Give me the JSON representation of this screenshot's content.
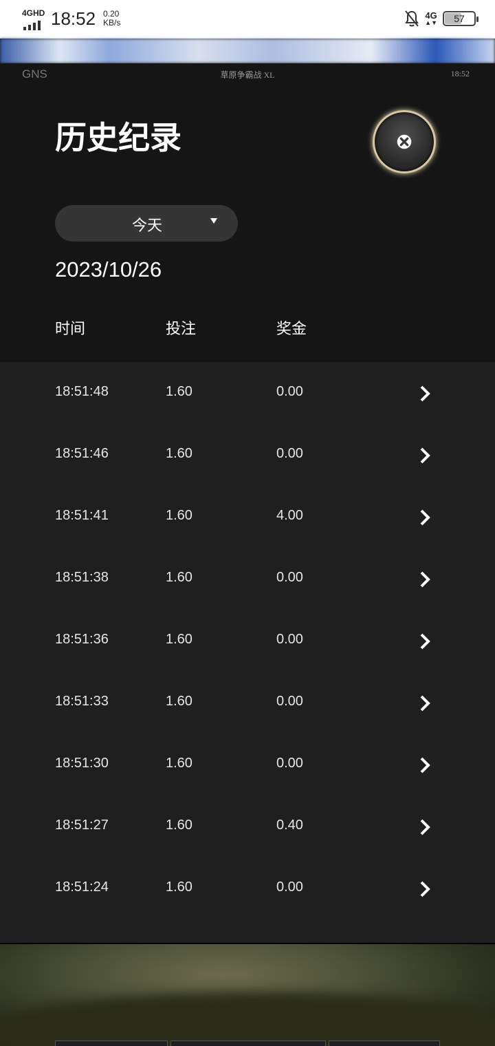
{
  "status_bar": {
    "network_label": "4GHD",
    "time": "18:52",
    "speed_value": "0.20",
    "speed_unit": "KB/s",
    "mobile_data_label": "4G",
    "battery_level": "57",
    "icons": [
      "signal-icon",
      "bell-off-icon",
      "mobile-data-icon",
      "battery-icon"
    ]
  },
  "game_header": {
    "brand": "GNS",
    "game_title": "草原争霸战 XL",
    "clock": "18:52"
  },
  "history": {
    "title": "历史纪录",
    "close_icon": "close-icon",
    "date_filter": {
      "selected": "今天"
    },
    "date": "2023/10/26",
    "columns": [
      "时间",
      "投注",
      "奖金"
    ],
    "rows": [
      {
        "time": "18:51:48",
        "bet": "1.60",
        "win": "0.00"
      },
      {
        "time": "18:51:46",
        "bet": "1.60",
        "win": "0.00"
      },
      {
        "time": "18:51:41",
        "bet": "1.60",
        "win": "4.00"
      },
      {
        "time": "18:51:38",
        "bet": "1.60",
        "win": "0.00"
      },
      {
        "time": "18:51:36",
        "bet": "1.60",
        "win": "0.00"
      },
      {
        "time": "18:51:33",
        "bet": "1.60",
        "win": "0.00"
      },
      {
        "time": "18:51:30",
        "bet": "1.60",
        "win": "0.00"
      },
      {
        "time": "18:51:27",
        "bet": "1.60",
        "win": "0.40"
      },
      {
        "time": "18:51:24",
        "bet": "1.60",
        "win": "0.00"
      }
    ]
  },
  "colors": {
    "panel_bg": "#151515",
    "table_bg": "#1f1f1f",
    "dropdown_bg": "#353535",
    "close_ring": "#d7c9a3"
  }
}
